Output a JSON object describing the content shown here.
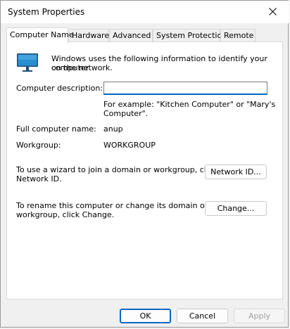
{
  "window": {
    "title": "System Properties"
  },
  "tabs": [
    {
      "label": "Computer Name",
      "active": true
    },
    {
      "label": "Hardware",
      "active": false
    },
    {
      "label": "Advanced",
      "active": false
    },
    {
      "label": "System Protection",
      "active": false
    },
    {
      "label": "Remote",
      "active": false
    }
  ],
  "computer_name": {
    "intro_line1": "Windows uses the following information to identify your computer",
    "intro_line2": "on the network.",
    "description_label": "Computer description:",
    "description_value": "",
    "example_line1": "For example: \"Kitchen Computer\" or \"Mary's",
    "example_line2": "Computer\".",
    "full_name_label": "Full computer name:",
    "full_name_value": "anup",
    "workgroup_label": "Workgroup:",
    "workgroup_value": "WORKGROUP",
    "network_id_text_line1": "To use a wizard to join a domain or workgroup, click",
    "network_id_text_line2": "Network ID.",
    "network_id_button": "Network ID...",
    "change_text_line1": "To rename this computer or change its domain or",
    "change_text_line2": "workgroup, click Change.",
    "change_button": "Change..."
  },
  "footer": {
    "ok": "OK",
    "cancel": "Cancel",
    "apply": "Apply"
  },
  "colors": {
    "accent": "#0067c0",
    "monitor_screen": "#2a8fd0",
    "monitor_stand": "#1c4f7a"
  },
  "icons": {
    "computer": "computer-monitor-icon",
    "close": "close-icon"
  }
}
